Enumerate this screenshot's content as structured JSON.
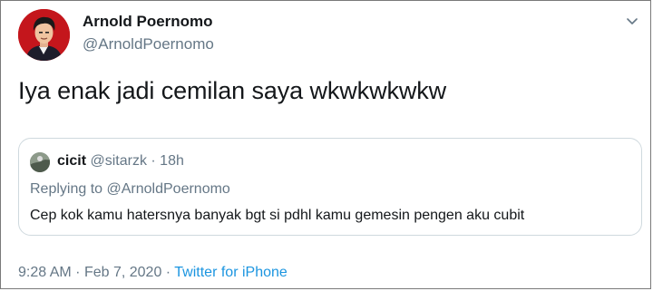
{
  "author": {
    "display_name": "Arnold Poernomo",
    "handle": "@ArnoldPoernomo"
  },
  "menu_icon": "chevron-down-icon",
  "tweet": {
    "text": "Iya enak jadi cemilan saya wkwkwkwkw"
  },
  "quoted_tweet": {
    "display_name": "cicit",
    "handle": "@sitarzk",
    "separator": "·",
    "time": "18h",
    "replying_prefix": "Replying to",
    "replying_to": "@ArnoldPoernomo",
    "text": "Cep kok kamu hatersnya banyak bgt si pdhl kamu gemesin pengen aku cubit"
  },
  "meta": {
    "time": "9:28 AM",
    "separator": "·",
    "date": "Feb 7, 2020",
    "source": "Twitter for iPhone"
  },
  "colors": {
    "text": "#14171a",
    "secondary": "#657786",
    "link": "#1b95e0",
    "border": "#cfd9de",
    "avatar_bg": "#c4161c"
  }
}
